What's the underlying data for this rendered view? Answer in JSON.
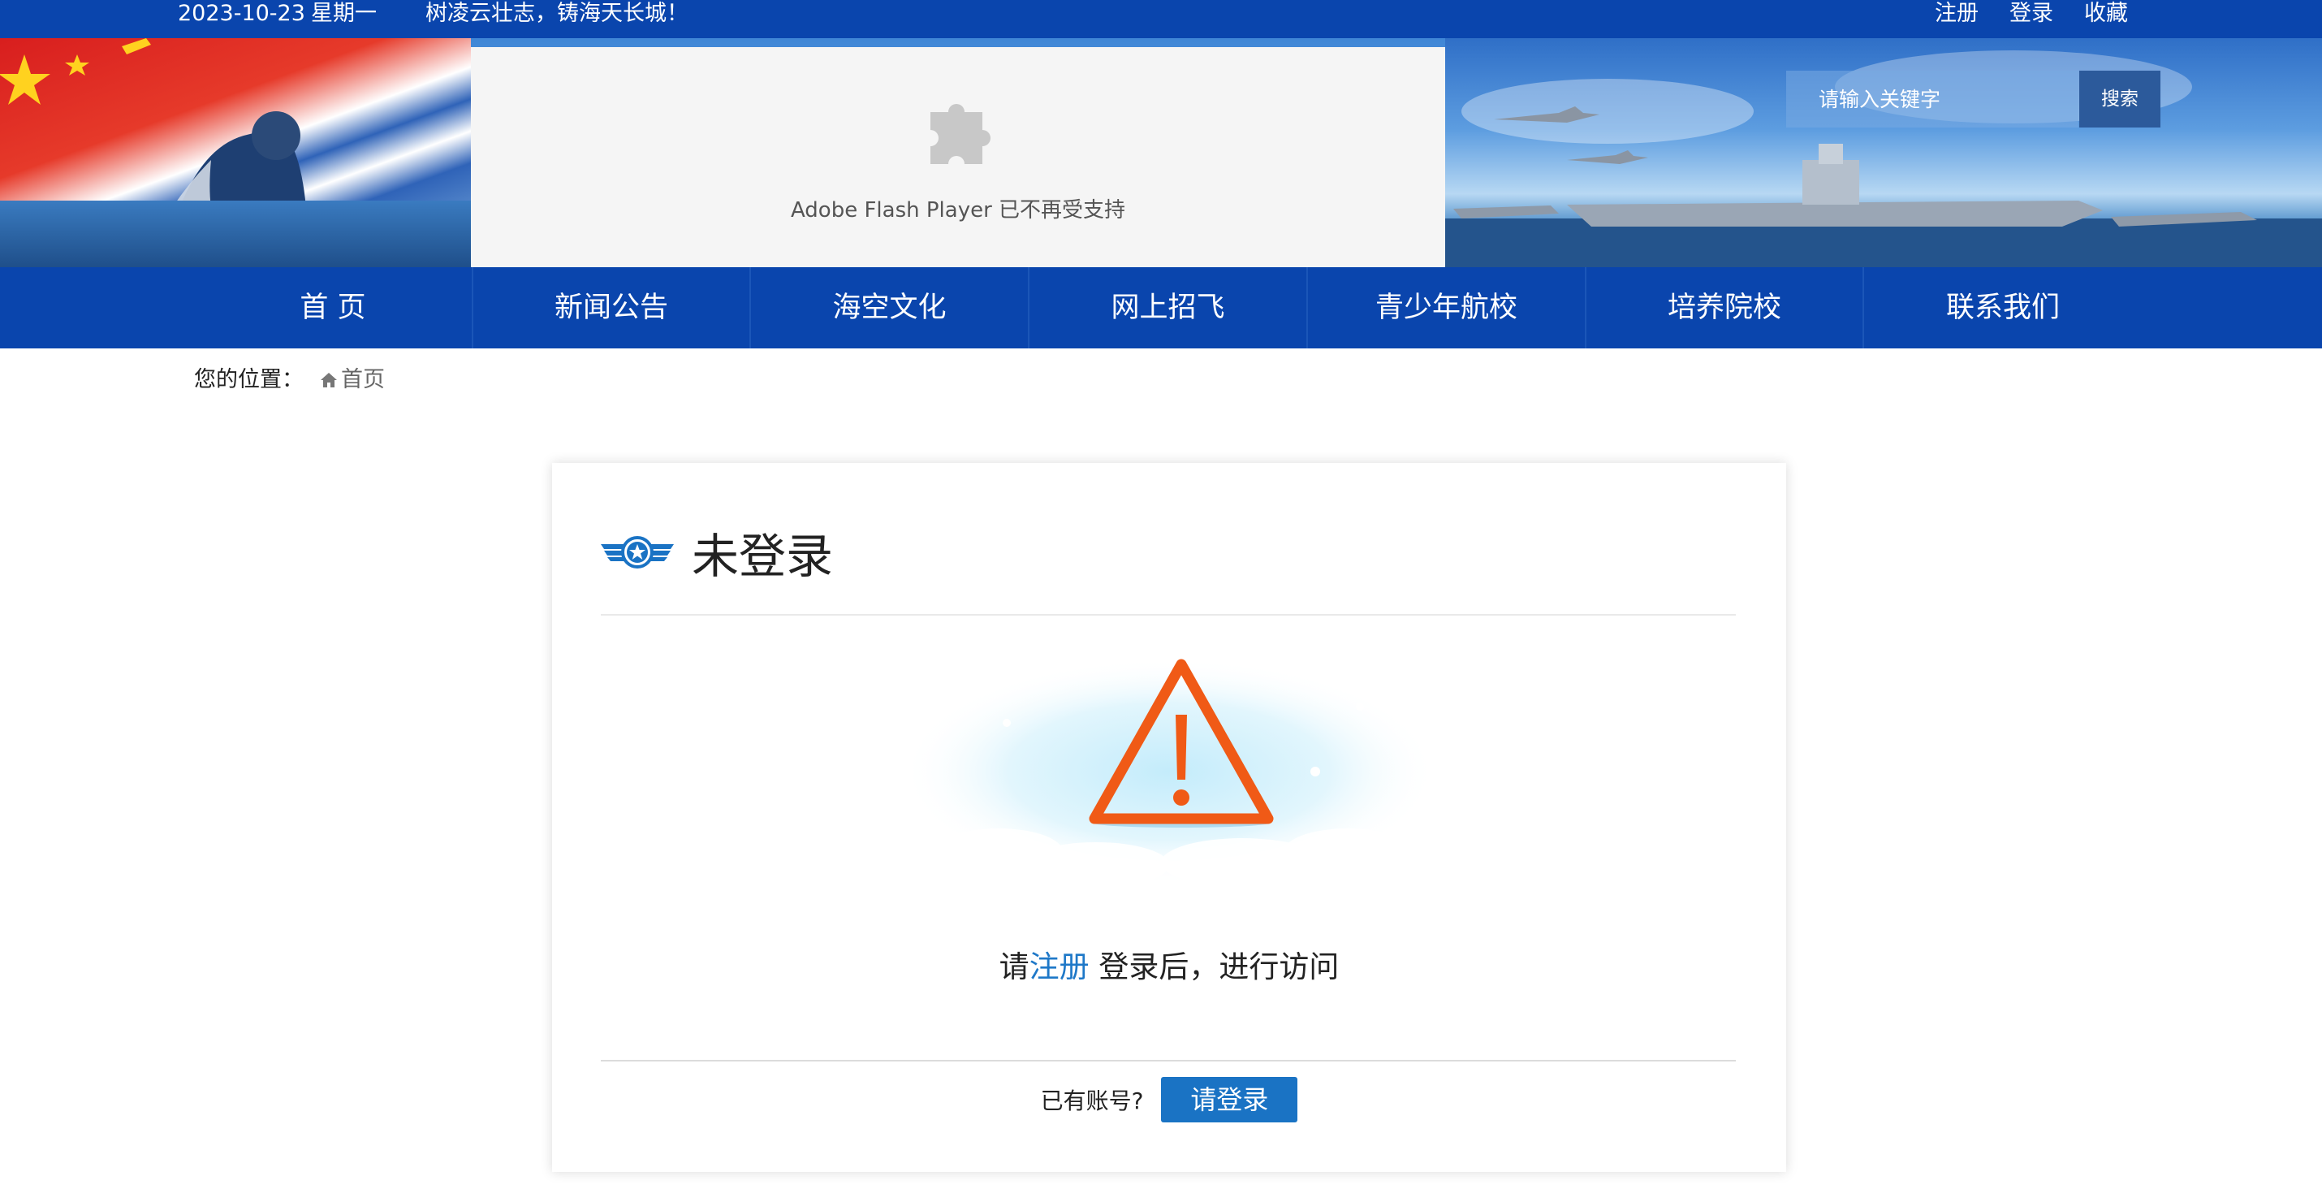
{
  "topbar": {
    "date": "2023-10-23",
    "weekday": "星期一",
    "slogan": "树凌云壮志，铸海天长城！",
    "links": [
      "注册",
      "登录",
      "收藏"
    ]
  },
  "flash": {
    "message": "Adobe Flash Player 已不再受支持",
    "icon": "puzzle-icon"
  },
  "search": {
    "placeholder": "请输入关键字",
    "button": "搜索"
  },
  "nav": {
    "items": [
      "首 页",
      "新闻公告",
      "海空文化",
      "网上招飞",
      "青少年航校",
      "培养院校",
      "联系我们"
    ]
  },
  "breadcrumb": {
    "label": "您的位置：",
    "home": "首页"
  },
  "card": {
    "title": "未登录",
    "notice_prefix": "请",
    "notice_register": "注册",
    "notice_suffix": " 登录后，进行访问",
    "have_account": "已有账号?",
    "login_button": "请登录"
  },
  "colors": {
    "primary": "#0a45ad",
    "link": "#1e78c8",
    "warning": "#f05a16",
    "button": "#1a73c4"
  }
}
